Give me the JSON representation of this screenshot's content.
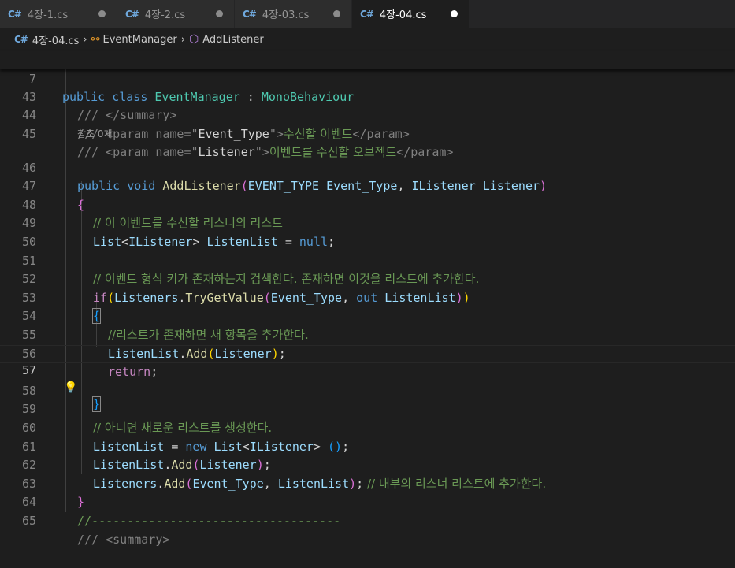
{
  "tabs": [
    {
      "label": "4장-1.cs",
      "active": false
    },
    {
      "label": "4장-2.cs",
      "active": false
    },
    {
      "label": "4장-03.cs",
      "active": false
    },
    {
      "label": "4장-04.cs",
      "active": true
    }
  ],
  "tab_icon_text": "C#",
  "breadcrumb": {
    "file": "4장-04.cs",
    "class": "EventManager",
    "method": "AddListener"
  },
  "sticky": {
    "line_number": "7",
    "kw1": "public",
    "kw2": "class",
    "class_name": "EventManager",
    "colon": " : ",
    "base": "MonoBehaviour"
  },
  "code_lens": "참조 0개",
  "lines": {
    "l43": {
      "num": "43",
      "a": "/// ",
      "b": "</summary>"
    },
    "l44": {
      "num": "44",
      "a": "/// ",
      "b": "<param name=\"",
      "c": "Event_Type",
      "d": "\">",
      "e": "수신할 이벤트",
      "f": "</param>"
    },
    "l45": {
      "num": "45",
      "a": "/// ",
      "b": "<param name=\"",
      "c": "Listener",
      "d": "\">",
      "e": "이벤트를 수신할 오브젝트",
      "f": "</param>"
    },
    "l46": {
      "num": "46",
      "kw1": "public",
      "kw2": "void",
      "fn": "AddListener",
      "p1": "(",
      "t1": "EVENT_TYPE",
      "v1": "Event_Type",
      "comma": ", ",
      "t2": "IListener",
      "v2": "Listener",
      "p2": ")"
    },
    "l47": {
      "num": "47",
      "brace": "{"
    },
    "l48": {
      "num": "48",
      "cmt": "// 이 이벤트를 수신할 리스너의 리스트"
    },
    "l49": {
      "num": "49",
      "t1": "List",
      "lt": "<",
      "t2": "IListener",
      "gt": ">",
      "v1": "ListenList",
      "eq": " = ",
      "kw": "null",
      "semi": ";"
    },
    "l50": {
      "num": "50"
    },
    "l51": {
      "num": "51",
      "cmt": "// 이벤트 형식 키가 존재하는지 검색한다. 존재하면 이것을 리스트에 추가한다."
    },
    "l52": {
      "num": "52",
      "kw": "if",
      "p1": "(",
      "v1": "Listeners",
      "dot": ".",
      "fn": "TryGetValue",
      "p2": "(",
      "v2": "Event_Type",
      "comma": ", ",
      "kw2": "out",
      "v3": "ListenList",
      "p3": ")",
      "p4": ")"
    },
    "l53": {
      "num": "53",
      "brace": "{"
    },
    "l54": {
      "num": "54",
      "cmt": "//리스트가 존재하면 새 항목을 추가한다."
    },
    "l55": {
      "num": "55",
      "v1": "ListenList",
      "dot": ".",
      "fn": "Add",
      "p1": "(",
      "v2": "Listener",
      "p2": ")",
      "semi": ";"
    },
    "l56": {
      "num": "56",
      "kw": "return",
      "semi": ";"
    },
    "l57": {
      "num": "57",
      "brace": "}"
    },
    "l58": {
      "num": "58"
    },
    "l59": {
      "num": "59",
      "cmt": "// 아니면 새로운 리스트를 생성한다."
    },
    "l60": {
      "num": "60",
      "v1": "ListenList",
      "eq": " = ",
      "kw": "new",
      "t1": "List",
      "lt": "<",
      "t2": "IListener",
      "gt": ">",
      "p": " ()",
      "semi": ";"
    },
    "l61": {
      "num": "61",
      "v1": "ListenList",
      "dot": ".",
      "fn": "Add",
      "p1": "(",
      "v2": "Listener",
      "p2": ")",
      "semi": ";"
    },
    "l62": {
      "num": "62",
      "v1": "Listeners",
      "dot": ".",
      "fn": "Add",
      "p1": "(",
      "v2": "Event_Type",
      "comma": ", ",
      "v3": "ListenList",
      "p2": ")",
      "semi": ";",
      "cmt": " // 내부의 리스너 리스트에 추가한다."
    },
    "l63": {
      "num": "63",
      "brace": "}"
    },
    "l64": {
      "num": "64",
      "cmt": "//-----------------------------------"
    },
    "l65": {
      "num": "65",
      "a": "/// ",
      "b": "<summary>"
    }
  },
  "lightbulb_icon": "lightbulb-icon",
  "colors": {
    "keyword": "#569cd6",
    "control": "#c586c0",
    "class": "#4ec9b0",
    "function": "#dcdcaa",
    "variable": "#9cdcfe",
    "comment": "#6a9955",
    "bracket1": "#ffd700",
    "bracket2": "#da70d6",
    "bracket3": "#179fff"
  }
}
